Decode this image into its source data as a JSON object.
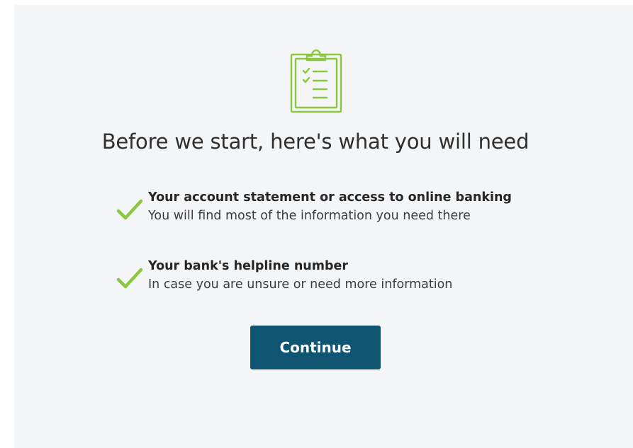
{
  "colors": {
    "accent_green": "#8dc63f",
    "button_bg": "#0f5470",
    "panel_bg": "#f4f5f7"
  },
  "header": {
    "icon": "clipboard-checklist-icon",
    "title": "Before we start, here's what you will need"
  },
  "requirements": [
    {
      "icon": "checkmark-icon",
      "title": "Your account statement or access to online banking",
      "description": "You will find most of the information you need there"
    },
    {
      "icon": "checkmark-icon",
      "title": "Your bank's helpline number",
      "description": "In case you are unsure or need more information"
    }
  ],
  "actions": {
    "continue_label": "Continue"
  }
}
